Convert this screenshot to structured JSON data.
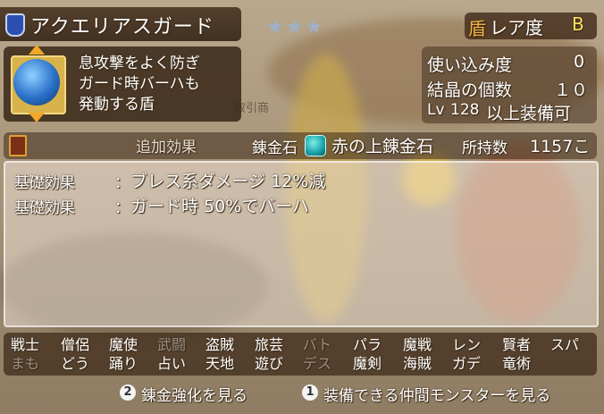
{
  "item": {
    "name": "アクエリアスガード",
    "rarity_label": "レア度",
    "rarity_value": "B",
    "rarity_icon": "盾",
    "stars": "★★★",
    "description": [
      "息攻撃をよく防ぎ",
      "ガード時バーハも",
      "発動する盾"
    ]
  },
  "stats": {
    "usage_label": "使い込み度",
    "usage_value": "0",
    "crystal_label": "結晶の個数",
    "crystal_value": "１０",
    "level_prefix": "Lv",
    "level_value": "128",
    "level_suffix": "以上装備可"
  },
  "alchemy": {
    "section_label": "追加効果",
    "stone_label": "錬金石",
    "stone_name": "赤の上錬金石",
    "owned_label": "所持数",
    "owned_value": "1157こ"
  },
  "effects": [
    {
      "label": "基礎効果",
      "sep": "：",
      "text": "ブレス系ダメージ 12%減"
    },
    {
      "label": "基礎効果",
      "sep": "：",
      "text": "ガード時 50%でバーハ"
    }
  ],
  "jobs": [
    {
      "name": "戦士",
      "enabled": true
    },
    {
      "name": "僧侶",
      "enabled": true
    },
    {
      "name": "魔使",
      "enabled": true
    },
    {
      "name": "武闘",
      "enabled": false
    },
    {
      "name": "盗賊",
      "enabled": true
    },
    {
      "name": "旅芸",
      "enabled": true
    },
    {
      "name": "バト",
      "enabled": false
    },
    {
      "name": "パラ",
      "enabled": true
    },
    {
      "name": "魔戦",
      "enabled": true
    },
    {
      "name": "レン",
      "enabled": true
    },
    {
      "name": "賢者",
      "enabled": true
    },
    {
      "name": "スパ",
      "enabled": true
    },
    {
      "name": "まも",
      "enabled": false
    },
    {
      "name": "どう",
      "enabled": true
    },
    {
      "name": "踊り",
      "enabled": true
    },
    {
      "name": "占い",
      "enabled": true
    },
    {
      "name": "天地",
      "enabled": true
    },
    {
      "name": "遊び",
      "enabled": true
    },
    {
      "name": "デス",
      "enabled": false
    },
    {
      "name": "魔剣",
      "enabled": true
    },
    {
      "name": "海賊",
      "enabled": true
    },
    {
      "name": "ガデ",
      "enabled": true
    },
    {
      "name": "竜術",
      "enabled": true
    }
  ],
  "buttons": {
    "alchemy_num": "2",
    "alchemy_label": "錬金強化を見る",
    "monster_num": "1",
    "monster_label": "装備できる仲間モンスターを見る"
  },
  "background_text": "取引商",
  "colors": {
    "accent": "#ffe060",
    "panel": "#3c2a1a",
    "job_disabled": "#9d8f86"
  }
}
